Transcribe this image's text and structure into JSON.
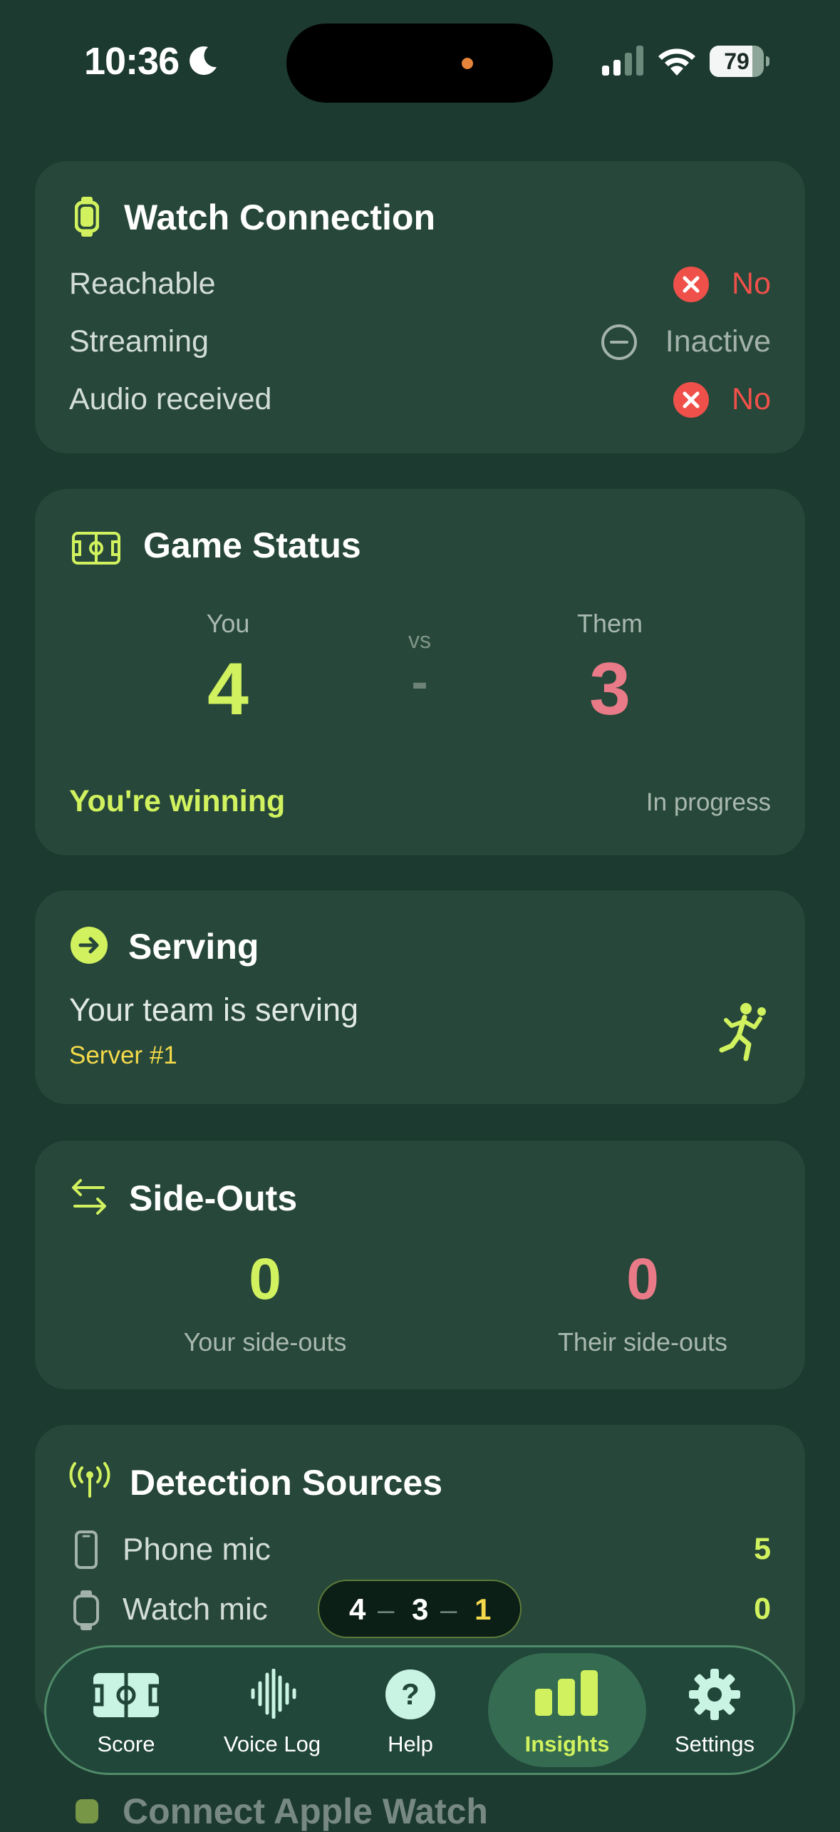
{
  "status_bar": {
    "time": "10:36",
    "battery": "79",
    "battery_level": 0.79
  },
  "watch_connection": {
    "title": "Watch Connection",
    "rows": [
      {
        "label": "Reachable",
        "value": "No"
      },
      {
        "label": "Streaming",
        "value": "Inactive"
      },
      {
        "label": "Audio received",
        "value": "No"
      }
    ]
  },
  "game_status": {
    "title": "Game Status",
    "you_label": "You",
    "you_score": "4",
    "vs": "vs",
    "dash": "-",
    "them_label": "Them",
    "them_score": "3",
    "result": "You're winning",
    "state": "In progress"
  },
  "serving": {
    "title": "Serving",
    "text": "Your team is serving",
    "server": "Server #1"
  },
  "side_outs": {
    "title": "Side-Outs",
    "yours": "0",
    "yours_label": "Your side-outs",
    "theirs": "0",
    "theirs_label": "Their side-outs"
  },
  "detection_sources": {
    "title": "Detection Sources",
    "rows": [
      {
        "label": "Phone mic",
        "value": "5"
      },
      {
        "label": "Watch mic",
        "value": "0"
      }
    ]
  },
  "connect_watch": {
    "title": "Connect Apple Watch"
  },
  "score_pill": {
    "you": "4",
    "them": "3",
    "server": "1"
  },
  "tab_bar": {
    "items": [
      {
        "label": "Score",
        "icon": "court-icon"
      },
      {
        "label": "Voice Log",
        "icon": "waveform-icon"
      },
      {
        "label": "Help",
        "icon": "help-icon"
      },
      {
        "label": "Insights",
        "icon": "bar-chart-icon",
        "active": true
      },
      {
        "label": "Settings",
        "icon": "gear-icon"
      }
    ]
  },
  "colors": {
    "background": "#1c3a2f",
    "card": "#264739",
    "accent_green": "#d1f25e",
    "accent_red": "#e97a87",
    "error_red": "#f0504a",
    "yellow": "#f4d94a"
  }
}
